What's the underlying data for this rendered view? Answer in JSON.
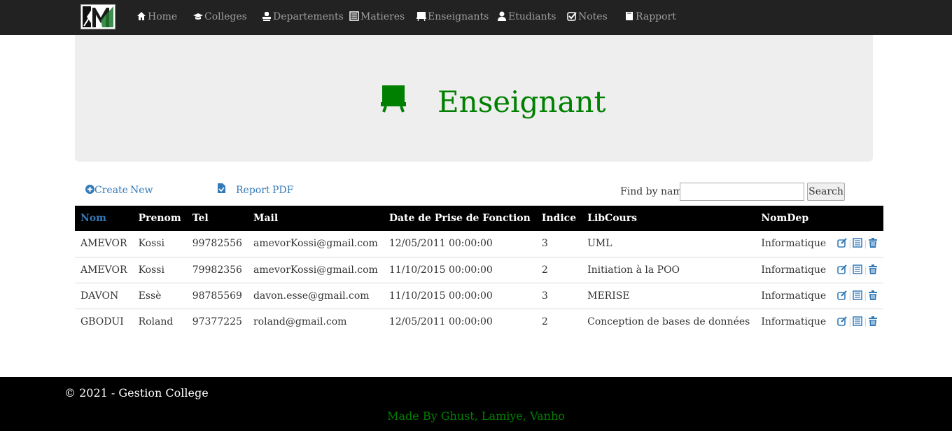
{
  "nav": {
    "items": [
      {
        "label": "Home",
        "icon": "home-icon"
      },
      {
        "label": "Colleges",
        "icon": "graduation-cap-icon"
      },
      {
        "label": "Departements",
        "icon": "stamp-icon"
      },
      {
        "label": "Matieres",
        "icon": "list-alt-icon"
      },
      {
        "label": "Enseignants",
        "icon": "blackboard-icon"
      },
      {
        "label": "Etudiants",
        "icon": "user-icon"
      },
      {
        "label": "Notes",
        "icon": "check-icon"
      },
      {
        "label": "Rapport",
        "icon": "book-icon"
      }
    ]
  },
  "page": {
    "title": "Enseignant",
    "title_color": "#008000"
  },
  "actions": {
    "create_label": "Create",
    "new_label": "New",
    "report_label": "Report",
    "pdf_label": "PDF",
    "find_label": "Find by name:",
    "find_value": "",
    "search_label": "Search"
  },
  "table": {
    "headers": [
      "Nom",
      "Prenom",
      "Tel",
      "Mail",
      "Date de Prise de Fonction",
      "Indice",
      "LibCours",
      "NomDep"
    ],
    "rows": [
      [
        "AMEVOR",
        "Kossi",
        "99782556",
        "amevorKossi@gmail.com",
        "12/05/2011 00:00:00",
        "3",
        "UML",
        "Informatique"
      ],
      [
        "AMEVOR",
        "Kossi",
        "79982356",
        "amevorKossi@gmail.com",
        "11/10/2015 00:00:00",
        "2",
        "Initiation à la POO",
        "Informatique"
      ],
      [
        "DAVON",
        "Essè",
        "98785569",
        "davon.esse@gmail.com",
        "11/10/2015 00:00:00",
        "3",
        "MERISE",
        "Informatique"
      ],
      [
        "GBODUI",
        "Roland",
        "97377225",
        "roland@gmail.com",
        "12/05/2011 00:00:00",
        "2",
        "Conception de bases de données",
        "Informatique"
      ]
    ],
    "row_separator": "|"
  },
  "footer": {
    "copyright": "© 2021 - Gestion College",
    "credits": "Made By Ghust, Lamiye, Vanho",
    "credits_color": "#008000"
  }
}
